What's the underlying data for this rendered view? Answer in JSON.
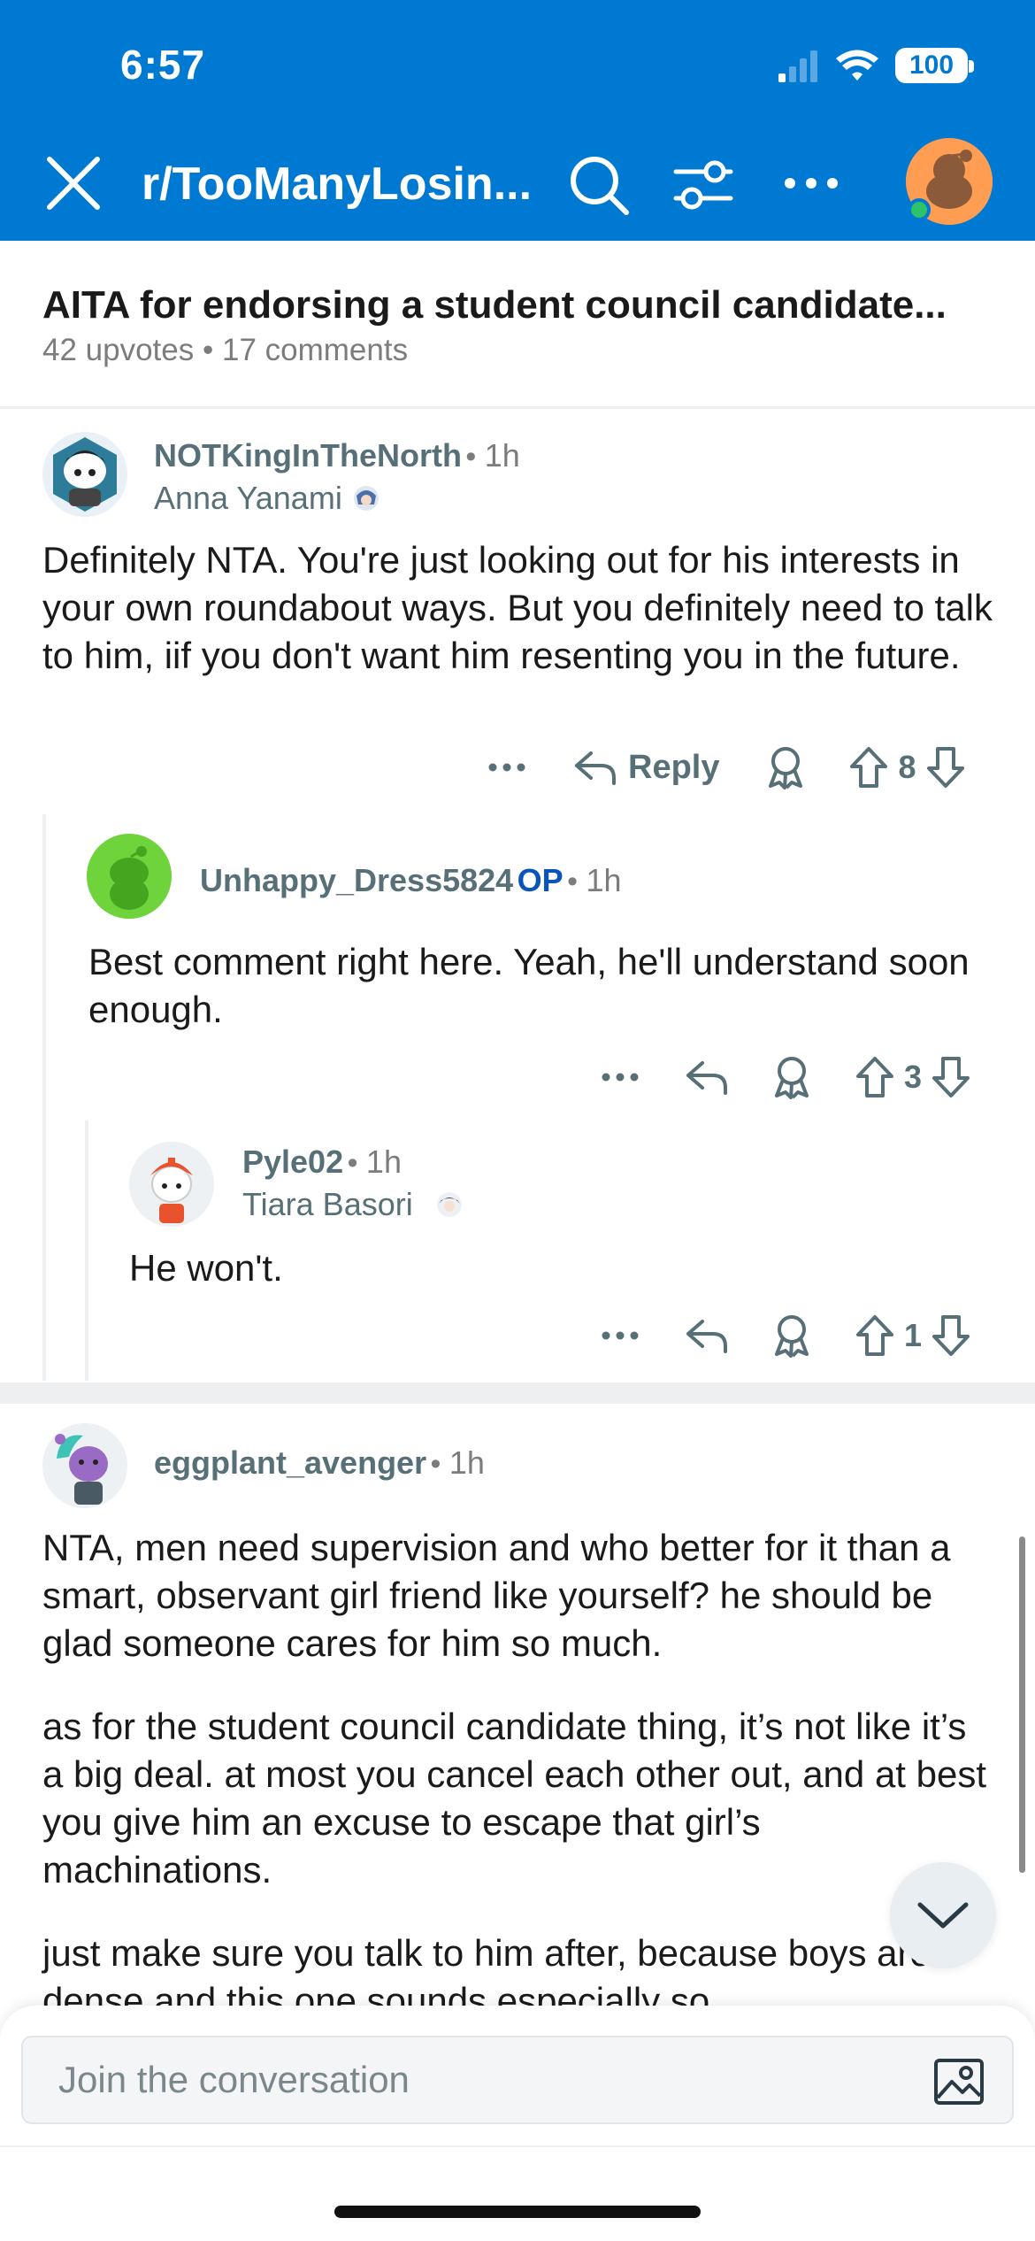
{
  "status": {
    "time": "6:57",
    "battery": "100"
  },
  "nav": {
    "subreddit": "r/TooManyLosin..."
  },
  "post": {
    "title": "AITA for endorsing a student council candidate...",
    "upvotes": "42 upvotes",
    "sep": "•",
    "comments": "17 comments"
  },
  "comments": [
    {
      "username": "NOTKingInTheNorth",
      "time": "1h",
      "flair": "Anna Yanami",
      "body": "Definitely NTA. You're just looking out for his interests in your own roundabout ways. But you definitely need to talk to him, iif you don't want him resenting you in the future.",
      "reply_label": "Reply",
      "votes": "8"
    },
    {
      "username": "Unhappy_Dress5824",
      "op_badge": "OP",
      "time": "1h",
      "body": "Best comment right here. Yeah, he'll understand soon enough.",
      "votes": "3"
    },
    {
      "username": "Pyle02",
      "time": "1h",
      "flair": "Tiara Basori",
      "body": "He won't.",
      "votes": "1"
    },
    {
      "username": "eggplant_avenger",
      "time": "1h",
      "paragraphs": [
        "NTA, men need supervision and who better for it than a smart, observant girl friend like yourself? he should be glad someone cares for him so much.",
        "as for the student council candidate thing, it’s not like it’s a big deal. at most you cancel each other out, and at best you give him an excuse to escape that girl’s machinations.",
        "just make sure you talk to him after, because boys are dense and this one sounds especially so."
      ]
    }
  ],
  "compose": {
    "placeholder": "Join the conversation"
  },
  "colors": {
    "header": "#0079d3",
    "op": "#0a53b8",
    "meta": "#576f76",
    "online": "#2ec36b"
  },
  "icons": [
    "close-icon",
    "search-icon",
    "filter-icon",
    "more-icon",
    "reply-icon",
    "award-icon",
    "upvote-icon",
    "downvote-icon",
    "chevron-down-icon",
    "image-icon",
    "wifi-icon",
    "signal-icon"
  ]
}
